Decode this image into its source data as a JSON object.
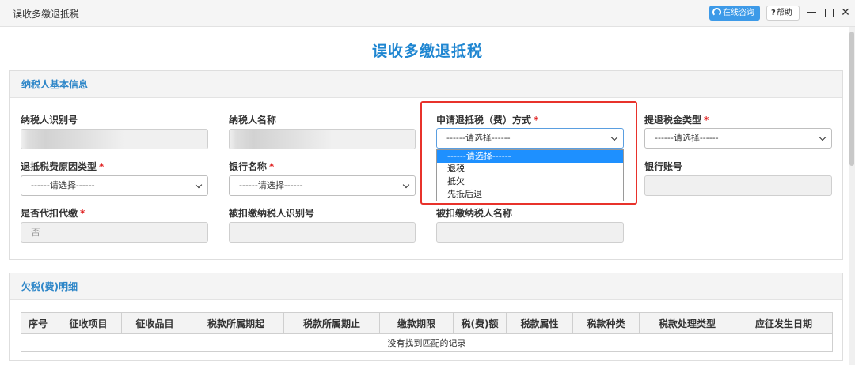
{
  "window": {
    "title": "误收多缴退抵税"
  },
  "toolbar": {
    "consult_label": "在线咨询",
    "help_label": "帮助",
    "help_mark": "?",
    "minimize_icon": "minimize-icon",
    "maximize_icon": "maximize-icon",
    "close_icon": "close-icon"
  },
  "page": {
    "title": "误收多缴退抵税"
  },
  "basic_info": {
    "heading": "纳税人基本信息",
    "fields": {
      "taxpayer_id": {
        "label": "纳税人识别号",
        "value": ""
      },
      "taxpayer_name": {
        "label": "纳税人名称",
        "value": ""
      },
      "refund_method": {
        "label": "申请退抵税（费）方式",
        "value": "------请选择------",
        "required": true
      },
      "refund_tax_type": {
        "label": "提退税金类型",
        "value": "------请选择------",
        "required": true
      },
      "reason_type": {
        "label": "退抵税费原因类型",
        "value": "------请选择------",
        "required": true
      },
      "bank_name": {
        "label": "银行名称",
        "value": "------请选择------",
        "required": true
      },
      "bank_account": {
        "label": "银行账号",
        "value": ""
      },
      "withholding": {
        "label": "是否代扣代缴",
        "value": "否",
        "required": true
      },
      "withheld_id": {
        "label": "被扣缴纳税人识别号",
        "value": ""
      },
      "withheld_name": {
        "label": "被扣缴纳税人名称",
        "value": ""
      }
    },
    "required_mark": "*",
    "refund_method_options": [
      "------请选择------",
      "退税",
      "抵欠",
      "先抵后退"
    ],
    "selected_option_index": 0
  },
  "arrears": {
    "heading": "欠税(费)明细",
    "columns": [
      "序号",
      "征收项目",
      "征收品目",
      "税款所属期起",
      "税款所属期止",
      "缴款期限",
      "税(费)额",
      "税款属性",
      "税款种类",
      "税款处理类型",
      "应征发生日期"
    ],
    "empty_text": "没有找到匹配的记录"
  },
  "colors": {
    "accent": "#1f86d1",
    "required": "#e02020",
    "highlight_border": "#e8322b",
    "consult_button": "#3d9ae8",
    "selected_option": "#1e90ff"
  }
}
